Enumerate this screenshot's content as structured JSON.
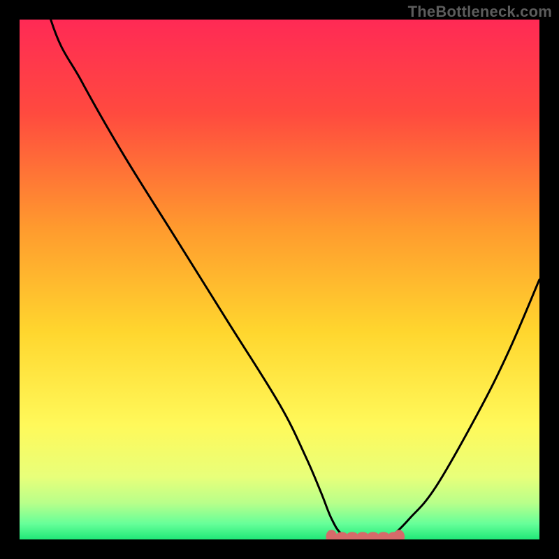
{
  "watermark": "TheBottleneck.com",
  "colors": {
    "black": "#000000",
    "curve": "#000000",
    "trough_dots": "#d66a6a",
    "gradient_stops": [
      {
        "pct": 0,
        "color": "#ff2a55"
      },
      {
        "pct": 18,
        "color": "#ff4a3f"
      },
      {
        "pct": 40,
        "color": "#ff9a2e"
      },
      {
        "pct": 60,
        "color": "#ffd62e"
      },
      {
        "pct": 78,
        "color": "#fff95a"
      },
      {
        "pct": 88,
        "color": "#e8ff7a"
      },
      {
        "pct": 93,
        "color": "#b8ff8a"
      },
      {
        "pct": 97,
        "color": "#66ff99"
      },
      {
        "pct": 100,
        "color": "#20e878"
      }
    ]
  },
  "chart_data": {
    "type": "line",
    "title": "",
    "xlabel": "",
    "ylabel": "",
    "xlim": [
      0,
      100
    ],
    "ylim": [
      0,
      100
    ],
    "note": "Bottleneck-style V-curve. y ≈ 0 around x ≈ 62–72 (optimal zone marked by red dots); y rises steeply toward 100 as x → 0 and moderately as x → 100.",
    "series": [
      {
        "name": "bottleneck_curve",
        "x": [
          0,
          6,
          12,
          20,
          30,
          40,
          50,
          55,
          58,
          60,
          62,
          65,
          68,
          70,
          72,
          75,
          80,
          88,
          94,
          100
        ],
        "y": [
          125,
          100,
          88,
          74,
          58,
          42,
          26,
          16,
          9,
          4,
          1,
          0,
          0,
          0,
          1,
          4,
          10,
          24,
          36,
          50
        ]
      }
    ],
    "optimal_zone": {
      "x_start": 60,
      "x_end": 73
    },
    "trough_markers_x": [
      60,
      62,
      64,
      66,
      68,
      70,
      72,
      73
    ]
  }
}
